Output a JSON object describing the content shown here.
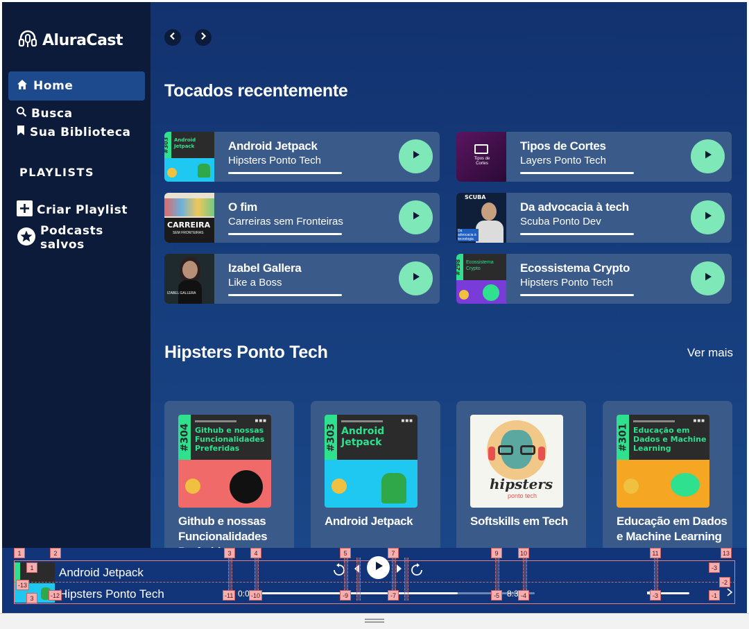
{
  "brand": {
    "name": "AluraCast"
  },
  "sidebar": {
    "home": "Home",
    "search": "Busca",
    "library": "Sua Biblioteca",
    "playlists_heading": "PLAYLISTS",
    "create_playlist": "Criar Playlist",
    "saved_podcasts": "Podcasts salvos"
  },
  "main": {
    "recent_title": "Tocados recentemente",
    "recent": [
      {
        "title": "Android Jetpack",
        "subtitle": "Hipsters Ponto Tech"
      },
      {
        "title": "Tipos de Cortes",
        "subtitle": "Layers Ponto Tech"
      },
      {
        "title": "O fim",
        "subtitle": "Carreiras sem Fronteiras"
      },
      {
        "title": "Da advocacia à tech",
        "subtitle": "Scuba Ponto Dev"
      },
      {
        "title": "Izabel Gallera",
        "subtitle": "Like a Boss"
      },
      {
        "title": "Ecossistema Crypto",
        "subtitle": "Hipsters Ponto Tech"
      }
    ],
    "section_title": "Hipsters Ponto Tech",
    "see_more": "Ver mais",
    "podcasts": [
      {
        "title": "Github e nossas Funcionalidades Preferidas",
        "cover_num": "#304",
        "cover_text": "Github e nossas Funcionalidades Preferidas"
      },
      {
        "title": "Android Jetpack",
        "cover_num": "#303",
        "cover_text": "Android Jetpack"
      },
      {
        "title": "Softskills em Tech",
        "cover_text": "hipsters"
      },
      {
        "title": "Educação em Dados e Machine Learning",
        "cover_num": "#301",
        "cover_text": "Educação em Dados e Machine Learning"
      }
    ],
    "thumb_text": {
      "recent_num_1": "#303",
      "recent_cover_1": "Android Jetpack",
      "tipos_cover": "Tipos de Cortes",
      "carreira_big": "CARREIRA",
      "carreira_small": "SEM FRONTEIRAS",
      "scuba_brand": "SCUBA",
      "scuba_ep": "Da advocacia à tecnologia",
      "izabel": "IZABEL GALLERA",
      "recent_num_6": "#298",
      "crypto_cover": "Ecossistema Crypto",
      "hipsters_sub": "ponto tech"
    }
  },
  "player": {
    "title": "Android Jetpack",
    "subtitle": "Hipsters Ponto Tech",
    "time_current": "0:0",
    "time_total": "8:3",
    "progress": 0.72,
    "volume": 0.75
  },
  "overlay": {
    "top_markers": [
      "1",
      "2",
      "3",
      "4",
      "5",
      "7",
      "9",
      "10",
      "11",
      "13"
    ],
    "mid_markers": [
      "1",
      "-13",
      "-3",
      "-2"
    ],
    "bottom_markers": [
      "3",
      "-12",
      "-11",
      "-10",
      "-9",
      "-7",
      "-5",
      "-4",
      "-3",
      "-1"
    ]
  },
  "colors": {
    "sidebar_bg": "#0b1b39",
    "main_bg": "#12357a",
    "card_bg": "#3a5a8a",
    "play_accent": "#7ee8b8",
    "active_nav": "#1d4a8c"
  }
}
